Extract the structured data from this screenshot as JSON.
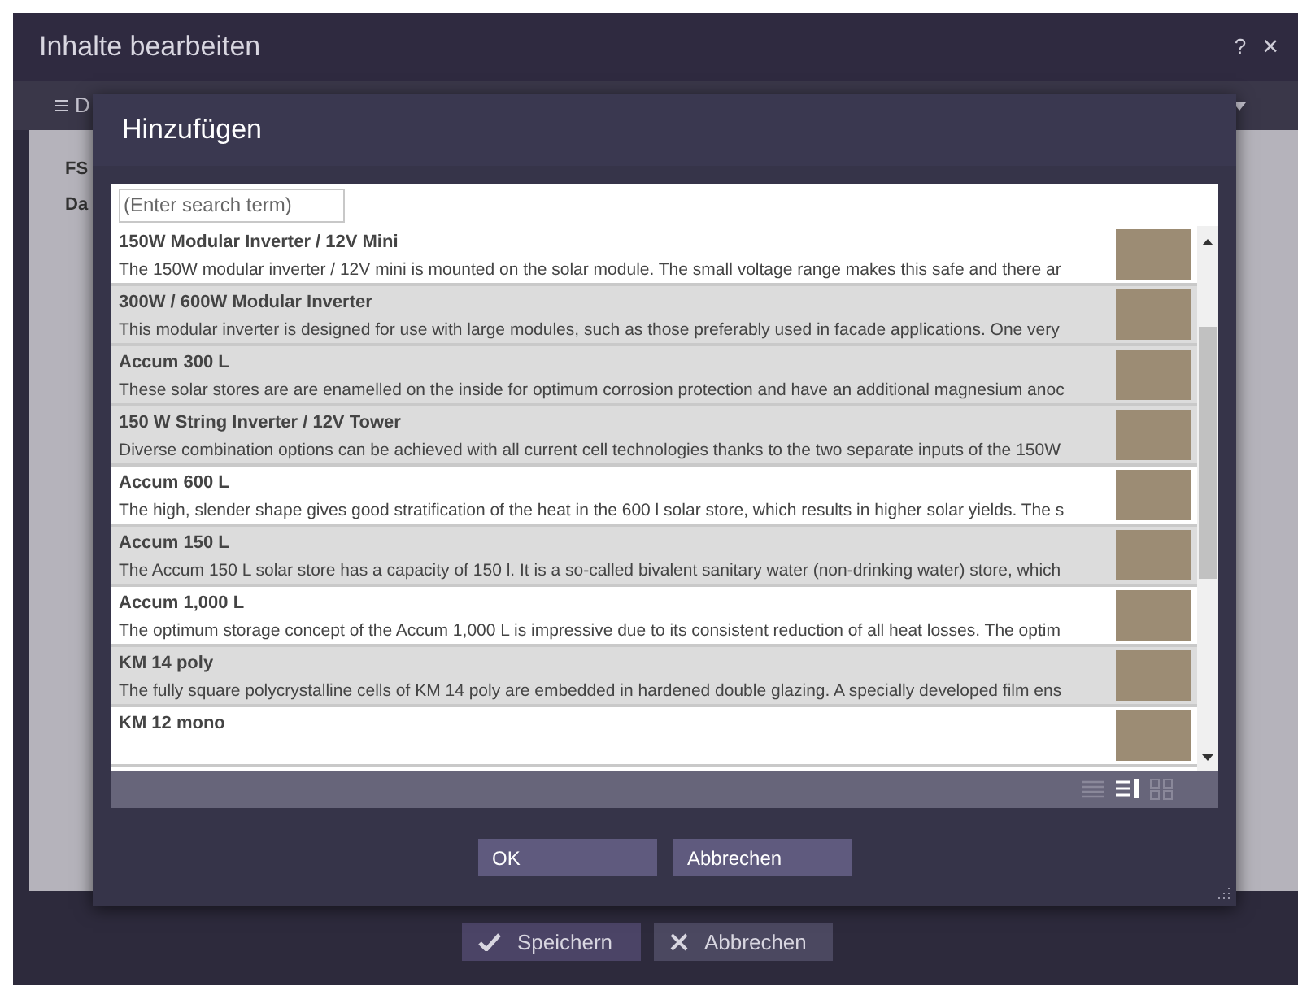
{
  "window": {
    "title": "Inhalte bearbeiten",
    "help": "?",
    "close": "×"
  },
  "toolbar": {
    "label": "D"
  },
  "form": {
    "labels": [
      "FS",
      "Da"
    ]
  },
  "footer_buttons": [
    {
      "kind": "save",
      "label": "Speichern"
    },
    {
      "kind": "cancel",
      "label": "Abbrechen"
    }
  ],
  "dialog": {
    "title": "Hinzufügen",
    "search": {
      "placeholder": "(Enter search term)"
    },
    "items": [
      {
        "title": "150W Modular Inverter / 12V Mini",
        "text": "The 150W modular inverter / 12V mini is mounted on the solar module. The small voltage range makes this safe and there ar",
        "selected": false
      },
      {
        "title": "300W / 600W Modular Inverter",
        "text": "This modular inverter is designed for use with large modules, such as those preferably used in facade applications. One very",
        "selected": true
      },
      {
        "title": "Accum 300 L",
        "text": "These solar stores are are enamelled on the inside for optimum corrosion protection and have an additional magnesium anoc",
        "selected": true
      },
      {
        "title": "150 W String Inverter / 12V Tower",
        "text": "Diverse combination options can be achieved with all current cell technologies thanks to the two separate inputs of the 150W",
        "selected": true
      },
      {
        "title": "Accum 600 L",
        "text": "The high, slender shape gives good stratification of the heat in the 600 l solar store, which results in higher solar yields. The s",
        "selected": false
      },
      {
        "title": "Accum 150 L",
        "text": "The Accum 150 L solar store has a capacity of 150 l. It is a so-called bivalent sanitary water (non-drinking water) store, which",
        "selected": true
      },
      {
        "title": "Accum 1,000 L",
        "text": "The optimum storage concept of the Accum 1,000 L is impressive due to its consistent reduction of all heat losses. The optim",
        "selected": false
      },
      {
        "title": "KM 14 poly",
        "text": "The fully square polycrystalline cells of KM 14 poly are embedded in hardened double glazing. A specially developed film ens",
        "selected": true
      },
      {
        "title": "KM 12 mono",
        "selected": false
      }
    ],
    "views": [
      {
        "kind": "list",
        "selected": false
      },
      {
        "kind": "details",
        "selected": true
      },
      {
        "kind": "grid",
        "selected": false
      }
    ],
    "buttons": [
      "OK",
      "Abbrechen"
    ]
  }
}
